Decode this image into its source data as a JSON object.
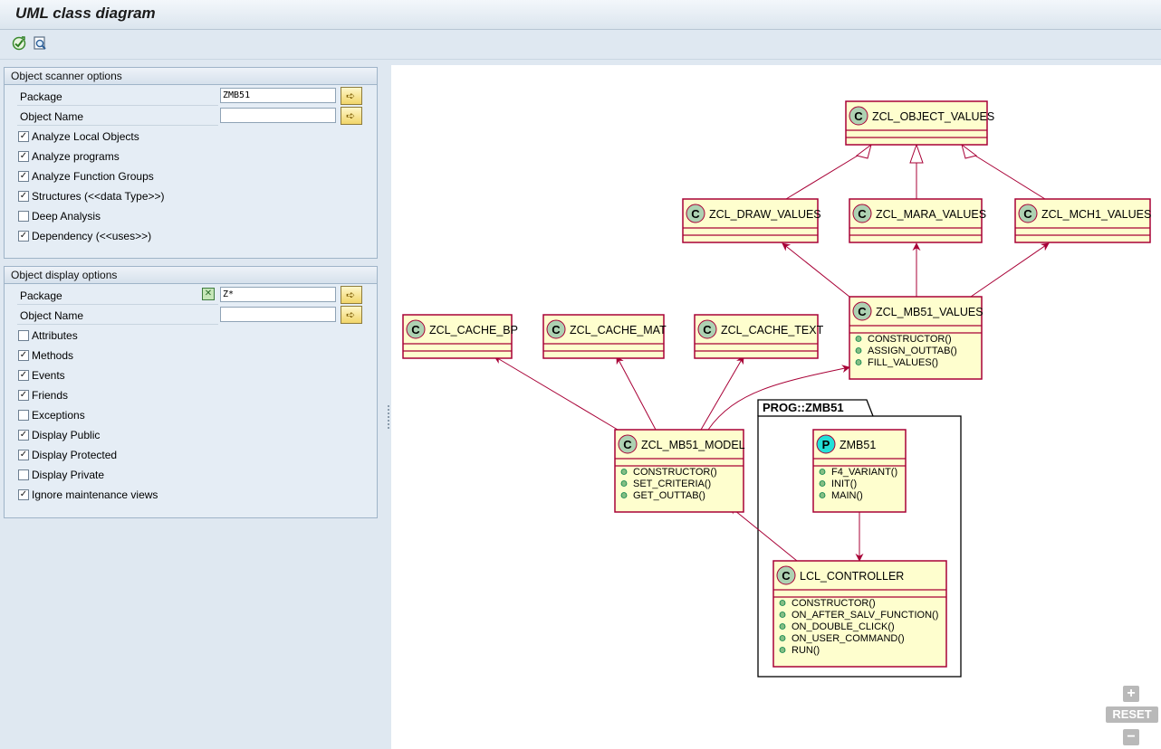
{
  "window": {
    "title": "UML class diagram"
  },
  "toolbar": {
    "icons": [
      "execute-icon",
      "display-icon"
    ]
  },
  "scanner": {
    "title": "Object scanner options",
    "package_label": "Package",
    "package_value": "ZMB51",
    "object_name_label": "Object Name",
    "object_name_value": "",
    "checkboxes": [
      {
        "label": "Analyze Local Objects",
        "checked": true
      },
      {
        "label": "Analyze programs",
        "checked": true
      },
      {
        "label": "Analyze Function Groups",
        "checked": true
      },
      {
        "label": "Structures (<<data Type>>)",
        "checked": true
      },
      {
        "label": "Deep Analysis",
        "checked": false
      },
      {
        "label": "Dependency (<<uses>>)",
        "checked": true
      }
    ]
  },
  "display": {
    "title": "Object display options",
    "package_label": "Package",
    "package_value": "Z*",
    "object_name_label": "Object Name",
    "object_name_value": "",
    "checkboxes": [
      {
        "label": "Attributes",
        "checked": false
      },
      {
        "label": "Methods",
        "checked": true
      },
      {
        "label": "Events",
        "checked": true
      },
      {
        "label": "Friends",
        "checked": true
      },
      {
        "label": "Exceptions",
        "checked": false
      },
      {
        "label": "Display Public",
        "checked": true
      },
      {
        "label": "Display Protected",
        "checked": true
      },
      {
        "label": "Display Private",
        "checked": false
      },
      {
        "label": "Ignore maintenance views",
        "checked": true
      }
    ]
  },
  "diagram": {
    "package_name": "PROG::ZMB51",
    "classes": {
      "object_values": {
        "stereotype": "C",
        "name": "ZCL_OBJECT_VALUES",
        "methods": []
      },
      "draw_values": {
        "stereotype": "C",
        "name": "ZCL_DRAW_VALUES",
        "methods": []
      },
      "mara_values": {
        "stereotype": "C",
        "name": "ZCL_MARA_VALUES",
        "methods": []
      },
      "mch1_values": {
        "stereotype": "C",
        "name": "ZCL_MCH1_VALUES",
        "methods": []
      },
      "mb51_values": {
        "stereotype": "C",
        "name": "ZCL_MB51_VALUES",
        "methods": [
          "CONSTRUCTOR()",
          "ASSIGN_OUTTAB()",
          "FILL_VALUES()"
        ]
      },
      "cache_bp": {
        "stereotype": "C",
        "name": "ZCL_CACHE_BP",
        "methods": []
      },
      "cache_mat": {
        "stereotype": "C",
        "name": "ZCL_CACHE_MAT",
        "methods": []
      },
      "cache_text": {
        "stereotype": "C",
        "name": "ZCL_CACHE_TEXT",
        "methods": []
      },
      "mb51_model": {
        "stereotype": "C",
        "name": "ZCL_MB51_MODEL",
        "methods": [
          "CONSTRUCTOR()",
          "SET_CRITERIA()",
          "GET_OUTTAB()"
        ]
      },
      "zmb51": {
        "stereotype": "P",
        "name": "ZMB51",
        "methods": [
          "F4_VARIANT()",
          "INIT()",
          "MAIN()"
        ]
      },
      "lcl_controller": {
        "stereotype": "C",
        "name": "LCL_CONTROLLER",
        "methods": [
          "CONSTRUCTOR()",
          "ON_AFTER_SALV_FUNCTION()",
          "ON_DOUBLE_CLICK()",
          "ON_USER_COMMAND()",
          "RUN()"
        ]
      }
    },
    "zoom": {
      "plus": "+",
      "reset": "RESET",
      "minus": "−"
    }
  }
}
